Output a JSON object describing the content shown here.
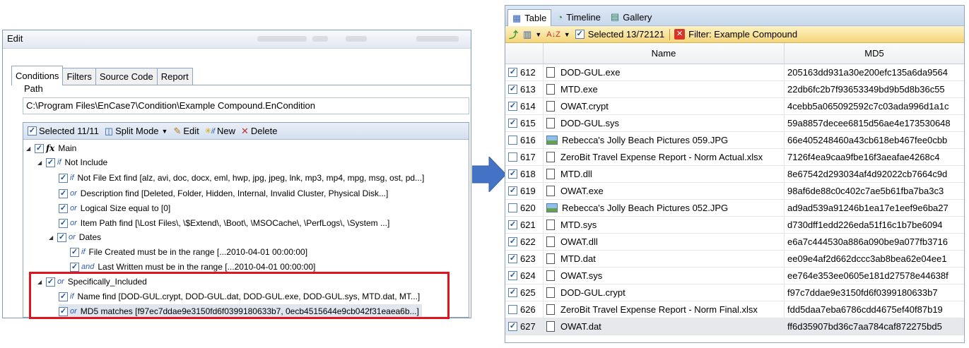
{
  "edit_window": {
    "title": "Edit",
    "tabs": [
      {
        "label": "Conditions"
      },
      {
        "label": "Filters"
      },
      {
        "label": "Source Code"
      },
      {
        "label": "Report"
      }
    ],
    "path_label": "Path",
    "path_value": "C:\\Program Files\\EnCase7\\Condition\\Example Compound.EnCondition",
    "toolbar": {
      "selected": "Selected 11/11",
      "split_mode": "Split Mode",
      "edit": "Edit",
      "new": "New",
      "delete": "Delete"
    },
    "tree": [
      {
        "op": "",
        "text": "Main"
      },
      {
        "op": "if",
        "text": "Not Include"
      },
      {
        "op": "if",
        "text": "Not File Ext find [alz, avi, doc, docx, eml, hwp, jpg, jpeg, lnk, mp3, mp4, mpg, msg, ost, pd...]"
      },
      {
        "op": "or",
        "text": "Description find [Deleted, Folder, Hidden, Internal, Invalid Cluster, Physical Disk...]"
      },
      {
        "op": "or",
        "text": "Logical Size equal to [0]"
      },
      {
        "op": "or",
        "text": "Item Path find [\\Lost Files\\, \\$Extend\\, \\Boot\\, \\MSOCache\\, \\PerfLogs\\, \\System ...]"
      },
      {
        "op": "or",
        "text": "Dates"
      },
      {
        "op": "if",
        "text": "File Created must be in the range [...2010-04-01 00:00:00]"
      },
      {
        "op": "and",
        "text": "Last Written must be in the range [...2010-04-01 00:00:00]"
      },
      {
        "op": "or",
        "text": "Specifically_Included"
      },
      {
        "op": "if",
        "text": "Name find [DOD-GUL.crypt, DOD-GUL.dat, DOD-GUL.exe, DOD-GUL.sys, MTD.dat, MT...]"
      },
      {
        "op": "or",
        "text": "MD5 matches [f97ec7ddae9e3150fd6f0399180633b7, 0ecb4515644e9cb042f31eaea6b...]"
      }
    ]
  },
  "table_window": {
    "tabs": [
      {
        "label": "Table"
      },
      {
        "label": "Timeline"
      },
      {
        "label": "Gallery"
      }
    ],
    "selected": "Selected 13/72121",
    "filter": "Filter: Example Compound",
    "columns": {
      "name": "Name",
      "md5": "MD5"
    },
    "rows": [
      {
        "num": "612",
        "checked": true,
        "icon": "doc",
        "name": "DOD-GUL.exe",
        "md5": "205163dd931a30e200efc135a6da9564"
      },
      {
        "num": "613",
        "checked": true,
        "icon": "doc",
        "name": "MTD.exe",
        "md5": "22db6fc2b7f93653349bd9b5d8b36c55"
      },
      {
        "num": "614",
        "checked": true,
        "icon": "doc",
        "name": "OWAT.crypt",
        "md5": "4cebb5a065092592c7c03ada996d1a1c"
      },
      {
        "num": "615",
        "checked": true,
        "icon": "doc",
        "name": "DOD-GUL.sys",
        "md5": "59a8857decee6815d56ae4e173530648"
      },
      {
        "num": "616",
        "checked": false,
        "icon": "img",
        "name": "Rebecca's Jolly Beach Pictures 059.JPG",
        "md5": "66e405248460a43cb618eb467fee0cbb"
      },
      {
        "num": "617",
        "checked": false,
        "icon": "doc",
        "name": "ZeroBit Travel Expense Report - Norm Actual.xlsx",
        "md5": "7126f4ea9caa9fbe16f3aeafae4268c4"
      },
      {
        "num": "618",
        "checked": true,
        "icon": "doc",
        "name": "MTD.dll",
        "md5": "8e67542d293034af4d92022cb7664c9d"
      },
      {
        "num": "619",
        "checked": true,
        "icon": "doc",
        "name": "OWAT.exe",
        "md5": "98af6de88c0c402c7ae5b61fba7ba3c3"
      },
      {
        "num": "620",
        "checked": false,
        "icon": "img",
        "name": "Rebecca's Jolly Beach Pictures 052.JPG",
        "md5": "ad9ad539a91246b1ea17e1eef9e6ba27"
      },
      {
        "num": "621",
        "checked": true,
        "icon": "doc",
        "name": "MTD.sys",
        "md5": "d730dff1edd226eda51f16c1b7be6094"
      },
      {
        "num": "622",
        "checked": true,
        "icon": "doc",
        "name": "OWAT.dll",
        "md5": "e6a7c444530a886a090be9a077fb3716"
      },
      {
        "num": "623",
        "checked": true,
        "icon": "doc",
        "name": "MTD.dat",
        "md5": "ee09e4af2d662dccc3ab8bea62e04ee1"
      },
      {
        "num": "624",
        "checked": true,
        "icon": "doc",
        "name": "OWAT.sys",
        "md5": "ee764e353ee0605e181d27578e44638f"
      },
      {
        "num": "625",
        "checked": true,
        "icon": "doc",
        "name": "DOD-GUL.crypt",
        "md5": "f97c7ddae9e3150fd6f0399180633b7"
      },
      {
        "num": "626",
        "checked": false,
        "icon": "doc",
        "name": "ZeroBit Travel Expense Report - Norm Final.xlsx",
        "md5": "fdd5daa7eba6786cdd4675ef40f87b19"
      },
      {
        "num": "627",
        "checked": true,
        "icon": "doc",
        "name": "OWAT.dat",
        "md5": "ff6d35907bd36c7aa784caf872275bd5"
      }
    ]
  },
  "colors": {
    "highlight": "#e0141e",
    "arrow": "#4472c4",
    "check": "#1b4f9c"
  }
}
